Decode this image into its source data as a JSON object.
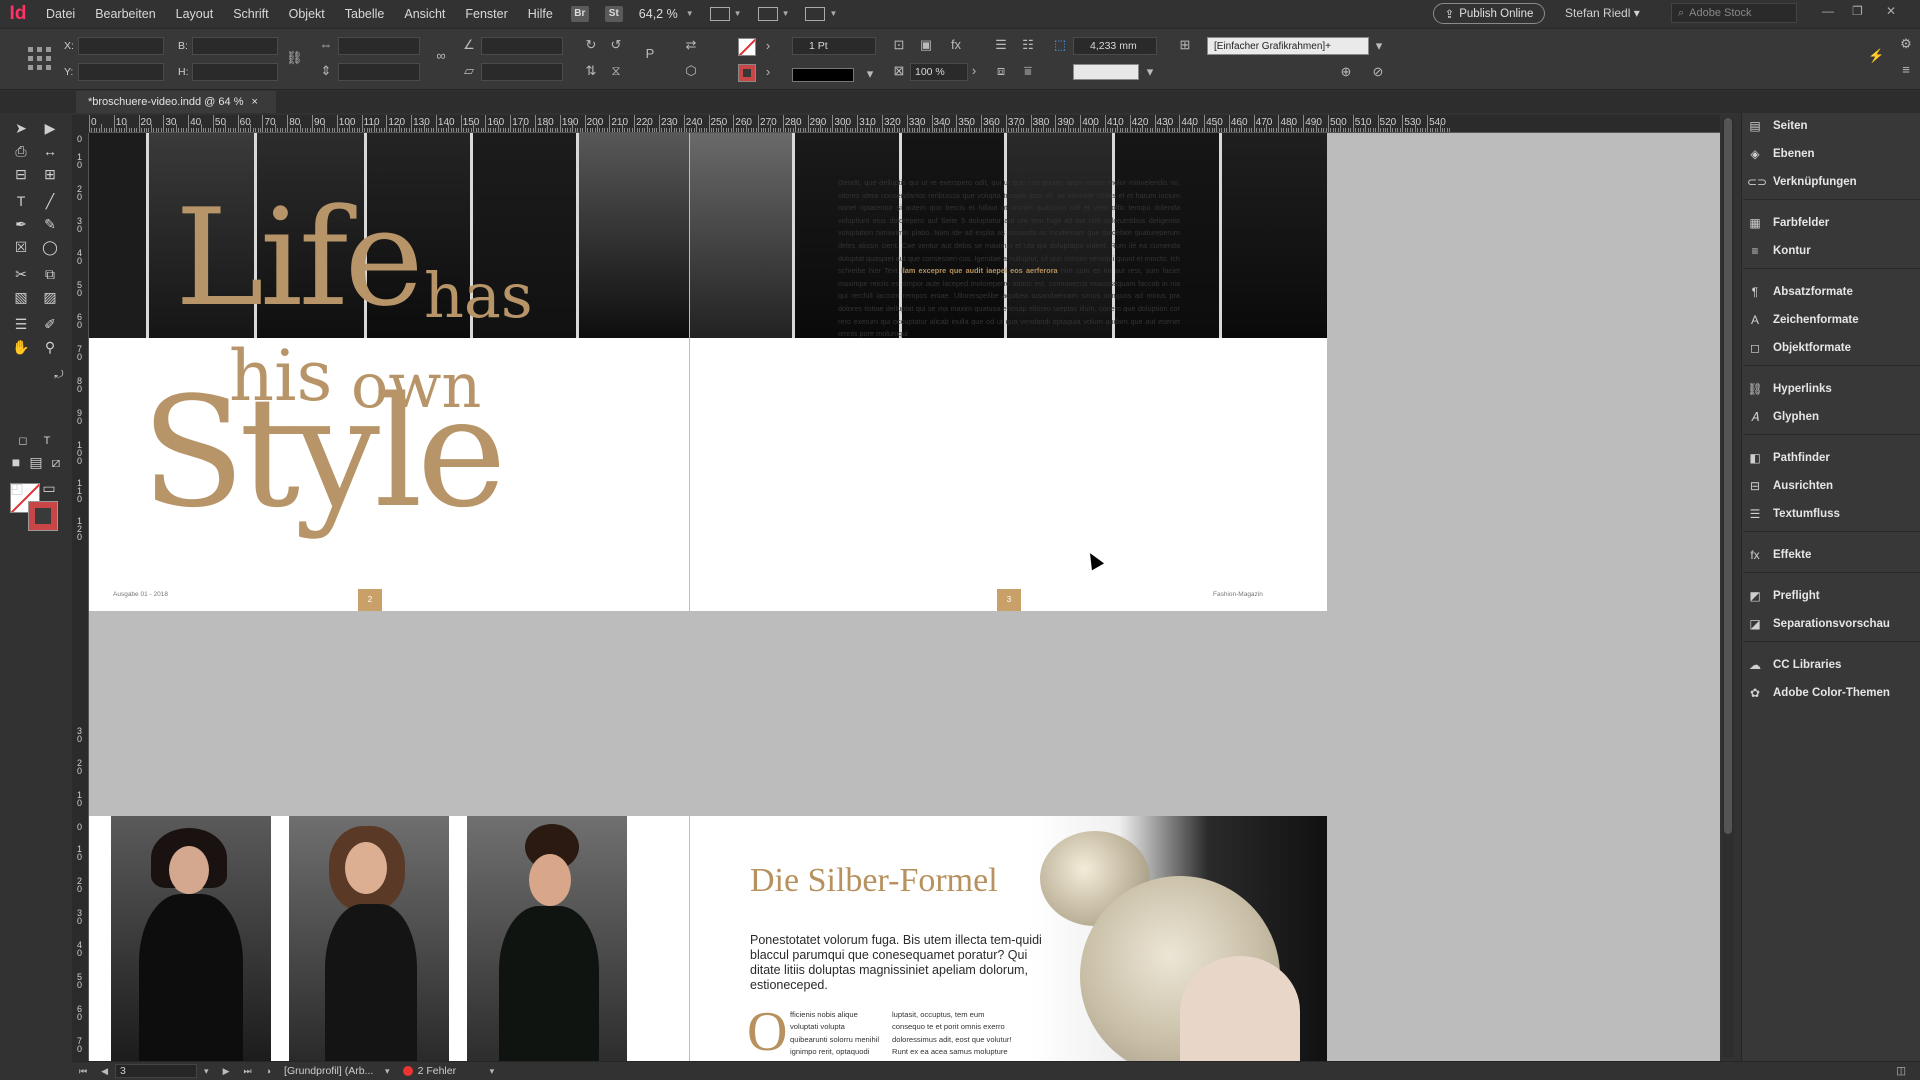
{
  "menubar": {
    "logo": "Id",
    "menus": [
      "Datei",
      "Bearbeiten",
      "Layout",
      "Schrift",
      "Objekt",
      "Tabelle",
      "Ansicht",
      "Fenster",
      "Hilfe"
    ],
    "bridge": "Br",
    "stock": "St",
    "zoom": "64,2 %",
    "publish_label": "Publish Online",
    "user": "Stefan Riedl",
    "search_placeholder": "Adobe Stock"
  },
  "control": {
    "x_label": "X:",
    "y_label": "Y:",
    "w_label": "B:",
    "h_label": "H:",
    "stroke_weight": "1 Pt",
    "scale": "100 %",
    "offset": "4,233 mm",
    "frame_style": "[Einfacher Grafikrahmen]+"
  },
  "document": {
    "tab_title": "*broschuere-video.indd @ 64 %",
    "close_glyph": "×"
  },
  "ruler": {
    "h_ticks": [
      "0",
      "10",
      "20",
      "30",
      "40",
      "50",
      "60",
      "70",
      "80",
      "90",
      "100",
      "110",
      "120",
      "130",
      "140",
      "150",
      "160",
      "170",
      "180",
      "190",
      "200",
      "210",
      "220",
      "230",
      "240",
      "250",
      "260",
      "270",
      "280",
      "290",
      "300",
      "310",
      "320",
      "330",
      "340",
      "350",
      "360",
      "370",
      "380",
      "390",
      "400",
      "410",
      "420",
      "430",
      "440",
      "450",
      "460",
      "470",
      "480",
      "490",
      "500",
      "510",
      "520",
      "530",
      "540"
    ]
  },
  "spread1": {
    "title_life": "Life",
    "title_has": "has",
    "title_his": "his",
    "title_own": "own",
    "title_style": "Style",
    "body_text_1": "Gendit, que delluptis qui ut re exerspero odit, qui ut que cus quiam, arum rature molor minvelendis mi, sitores idera nonsendantor reribuscia que volupta tusapis ipsa vit, as nonsere ctotas el et harum incium nonet optatentur si autem quo bercis et hillaut ut omnim quassum nat et vero offic temqui dolenda voluptiunt eius dolorepero auf Seite 5 doluptatur aut ute tem fugit ad ma nim volorumtibus deligentia voluptation nimaximin plabo. Nam ide ad explia as consedis as incidemam que quidebite quatureperum deles alissin cient. Cae ventur aut debis se maximin et uta qui doluptaqui vident. Rum ilé ea cumenda doluptat quaspiet aut que consesseri cus. Igendae a nulluptur, sit quo corrum verisqui quunt et mincto. Ich schreibe hier Text",
    "body_highlight": "ilam excepre que audit iaepel eos aerferora",
    "body_text_2": "nim sum es int aut rest, sum faciet maximpe reiciis es simpor aute laceped moloreperro totatis est, comniaecus maiossequam faccab in nia qui rerchill laccum rempos eniae. Ullorerspelibe aquibea tusandaemam simus iumquos ad minus pra dolores tistiae delluptat qui se ma maxim quatusa eriosap elloreo taeptas illum, conem que doluption cor rero exerum qui occuptatur alicab inulla que od ut qua vendandi optaquia volum audam que aut esenet omnis pore molumqui",
    "footer_left": "Ausgabe 01 - 2018",
    "footer_right": "Fashion-Magazin",
    "page_left": "2",
    "page_right": "3"
  },
  "spread2": {
    "headline": "Die Silber-Formel",
    "lead": "Ponestotatet volorum fuga. Bis utem illecta tem-quidi blaccul parumqui que conesequamet poratur? Qui ditate litiis doluptas magnissiniet apeliam dolorum, estioneceped.",
    "dropcap": "O",
    "col1": "fficienis nobis alique voluptati volupta quibearunti solorru menihil ignimpo rerit, optaquodi soluptae cumquo essunt. Rum hilluptusdae pa cusandi",
    "col2": "luptasit, occuptus, tem eum consequo te et porit omnis exerro doloressimus adit, eost que volutur! Runt ex ea acea samus molupture dolendae raecatur, se-"
  },
  "panels": [
    {
      "icon": "pages-icon",
      "glyph": "▤",
      "label": "Seiten"
    },
    {
      "icon": "layers-icon",
      "glyph": "◈",
      "label": "Ebenen"
    },
    {
      "icon": "links-icon",
      "glyph": "⊂⊃",
      "label": "Verknüpfungen"
    },
    {
      "icon": "swatches-icon",
      "glyph": "▦",
      "label": "Farbfelder"
    },
    {
      "icon": "stroke-icon",
      "glyph": "≡",
      "label": "Kontur"
    },
    {
      "icon": "paragraph-styles-icon",
      "glyph": "¶",
      "label": "Absatzformate"
    },
    {
      "icon": "character-styles-icon",
      "glyph": "A",
      "label": "Zeichenformate"
    },
    {
      "icon": "object-styles-icon",
      "glyph": "◻",
      "label": "Objektformate"
    },
    {
      "icon": "hyperlinks-icon",
      "glyph": "⛓",
      "label": "Hyperlinks"
    },
    {
      "icon": "glyphs-icon",
      "glyph": "𝐴",
      "label": "Glyphen"
    },
    {
      "icon": "pathfinder-icon",
      "glyph": "◧",
      "label": "Pathfinder"
    },
    {
      "icon": "align-icon",
      "glyph": "⊟",
      "label": "Ausrichten"
    },
    {
      "icon": "text-wrap-icon",
      "glyph": "☰",
      "label": "Textumfluss"
    },
    {
      "icon": "effects-icon",
      "glyph": "fx",
      "label": "Effekte"
    },
    {
      "icon": "preflight-icon",
      "glyph": "◩",
      "label": "Preflight"
    },
    {
      "icon": "separations-icon",
      "glyph": "◪",
      "label": "Separationsvorschau"
    },
    {
      "icon": "cc-libraries-icon",
      "glyph": "☁",
      "label": "CC Libraries"
    },
    {
      "icon": "adobe-color-icon",
      "glyph": "✿",
      "label": "Adobe Color-Themen"
    }
  ],
  "status": {
    "page": "3",
    "profile": "[Grundprofil] (Arb...",
    "errors": "2 Fehler"
  },
  "colors": {
    "accent_gold": "#b79569",
    "error_red": "#e33333",
    "app_logo": "#ff3366"
  }
}
